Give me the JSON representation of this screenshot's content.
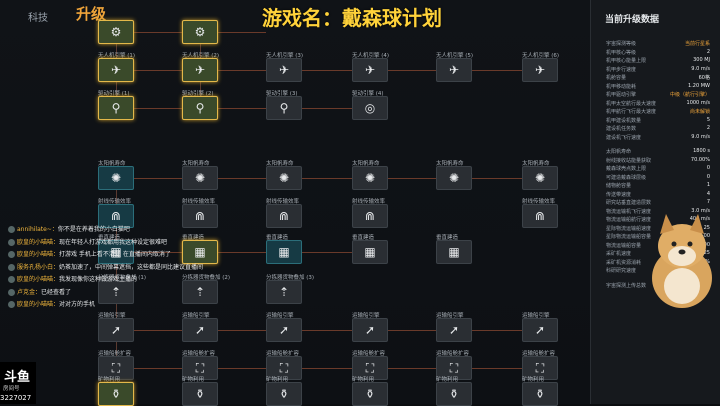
{
  "header": {
    "tech_tab": "科技",
    "upgrade_label": "升级",
    "game_title": "游戏名：戴森球计划"
  },
  "nodes": [
    {
      "id": "r0c0",
      "label": "",
      "glyph": "⚙",
      "hl": true
    },
    {
      "id": "r0c1",
      "label": "",
      "glyph": "⚙",
      "hl": true
    },
    {
      "id": "r1c0",
      "label": "无人机引擎 (1)",
      "glyph": "✈",
      "hl": true
    },
    {
      "id": "r1c1",
      "label": "无人机引擎 (2)",
      "glyph": "✈",
      "hl": true
    },
    {
      "id": "r1c2",
      "label": "无人机引擎 (3)",
      "glyph": "✈"
    },
    {
      "id": "r1c3",
      "label": "无人机引擎 (4)",
      "glyph": "✈"
    },
    {
      "id": "r1c4",
      "label": "无人机引擎 (5)",
      "glyph": "✈"
    },
    {
      "id": "r1c5",
      "label": "无人机引擎 (6)",
      "glyph": "✈"
    },
    {
      "id": "r2c0",
      "label": "驱动引擎 (1)",
      "glyph": "⚲",
      "hl": true
    },
    {
      "id": "r2c1",
      "label": "驱动引擎 (2)",
      "glyph": "⚲",
      "hl": true
    },
    {
      "id": "r2c2",
      "label": "驱动引擎 (3)",
      "glyph": "⚲"
    },
    {
      "id": "r2c3",
      "label": "驱动引擎 (4)",
      "glyph": "◎"
    },
    {
      "id": "r3c0",
      "label": "太阳帆寿命",
      "glyph": "✺",
      "teal": true
    },
    {
      "id": "r3c1",
      "label": "太阳帆寿命",
      "glyph": "✺"
    },
    {
      "id": "r3c2",
      "label": "太阳帆寿命",
      "glyph": "✺"
    },
    {
      "id": "r3c3",
      "label": "太阳帆寿命",
      "glyph": "✺"
    },
    {
      "id": "r3c4",
      "label": "太阳帆寿命",
      "glyph": "✺"
    },
    {
      "id": "r3c5",
      "label": "太阳帆寿命",
      "glyph": "✺"
    },
    {
      "id": "r4c0",
      "label": "射线传输效率",
      "glyph": "⋒",
      "teal": true
    },
    {
      "id": "r4c1",
      "label": "射线传输效率",
      "glyph": "⋒"
    },
    {
      "id": "r4c2",
      "label": "射线传输效率",
      "glyph": "⋒"
    },
    {
      "id": "r4c3",
      "label": "射线传输效率",
      "glyph": "⋒"
    },
    {
      "id": "r4c5",
      "label": "射线传输效率",
      "glyph": "⋒"
    },
    {
      "id": "r5c0",
      "label": "垂直建造",
      "glyph": "▦",
      "teal": true
    },
    {
      "id": "r5c1",
      "label": "垂直建造",
      "glyph": "▦",
      "hl": true
    },
    {
      "id": "r5c2",
      "label": "垂直建造",
      "glyph": "▦",
      "teal": true
    },
    {
      "id": "r5c3",
      "label": "垂直建造",
      "glyph": "▦"
    },
    {
      "id": "r5c4",
      "label": "垂直建造",
      "glyph": "▦"
    },
    {
      "id": "r6c0",
      "label": "分拣器货物叠加 (1)",
      "glyph": "⇡"
    },
    {
      "id": "r6c1",
      "label": "分拣器货物叠加 (2)",
      "glyph": "⇡"
    },
    {
      "id": "r6c2",
      "label": "分拣器货物叠加 (3)",
      "glyph": "⇡"
    },
    {
      "id": "r7c0",
      "label": "运输船引擎",
      "glyph": "➚"
    },
    {
      "id": "r7c1",
      "label": "运输船引擎",
      "glyph": "➚"
    },
    {
      "id": "r7c2",
      "label": "运输船引擎",
      "glyph": "➚"
    },
    {
      "id": "r7c3",
      "label": "运输船引擎",
      "glyph": "➚"
    },
    {
      "id": "r7c4",
      "label": "运输船引擎",
      "glyph": "➚"
    },
    {
      "id": "r7c5",
      "label": "运输船引擎",
      "glyph": "➚"
    },
    {
      "id": "r8c0",
      "label": "运输船舱扩容",
      "glyph": "⛶"
    },
    {
      "id": "r8c1",
      "label": "运输船舱扩容",
      "glyph": "⛶"
    },
    {
      "id": "r8c2",
      "label": "运输船舱扩容",
      "glyph": "⛶"
    },
    {
      "id": "r8c3",
      "label": "运输船舱扩容",
      "glyph": "⛶"
    },
    {
      "id": "r8c4",
      "label": "运输船舱扩容",
      "glyph": "⛶"
    },
    {
      "id": "r8c5",
      "label": "运输船舱扩容",
      "glyph": "⛶"
    },
    {
      "id": "r9c0",
      "label": "矿物利用",
      "glyph": "⚱",
      "hl": true
    },
    {
      "id": "r9c1",
      "label": "矿物利用",
      "glyph": "⚱"
    },
    {
      "id": "r9c2",
      "label": "矿物利用",
      "glyph": "⚱"
    },
    {
      "id": "r9c3",
      "label": "矿物利用",
      "glyph": "⚱"
    },
    {
      "id": "r9c4",
      "label": "矿物利用",
      "glyph": "⚱"
    },
    {
      "id": "r9c5",
      "label": "矿物利用",
      "glyph": "⚱"
    }
  ],
  "panel": {
    "title": "当前升级数据",
    "rows": [
      {
        "k": "宇宙探测等级",
        "v": "当前行星系",
        "o": true
      },
      {
        "k": "机甲核心等级",
        "v": "2"
      },
      {
        "k": "机甲核心能量上限",
        "v": "300 MJ"
      },
      {
        "k": "机甲步行速度",
        "v": "9.0 m/s"
      },
      {
        "k": "机舱容量",
        "v": "60格"
      },
      {
        "k": "机甲移动能耗",
        "v": "1.20 MW"
      },
      {
        "k": "机甲驱动引擎",
        "v": "中级（航行引擎）",
        "o": true
      },
      {
        "k": "机甲太空航行最大速度",
        "v": "1000 m/s"
      },
      {
        "k": "机甲航行飞行最大速度",
        "v": "尚未解锁",
        "o": true
      },
      {
        "k": "机甲建设机数量",
        "v": "5"
      },
      {
        "k": "建设机任务数",
        "v": "2"
      },
      {
        "k": "建设机飞行速度",
        "v": "9.0 m/s"
      },
      {
        "k": "",
        "v": ""
      },
      {
        "k": "太阳帆寿命",
        "v": "1800 s"
      },
      {
        "k": "射线接收站能量获取",
        "v": "70.00%"
      },
      {
        "k": "戴森球壳点数上限",
        "v": "0"
      },
      {
        "k": "可建造戴森球层级",
        "v": "0"
      },
      {
        "k": "储物舱容量",
        "v": "1"
      },
      {
        "k": "传送带速度",
        "v": "4"
      },
      {
        "k": "研究站垂直建造层数",
        "v": "7"
      },
      {
        "k": "物流运输机飞行速度",
        "v": "3.0 m/s"
      },
      {
        "k": "物流运输船航行速度",
        "v": "400 m/s"
      },
      {
        "k": "星际物流运输船速度",
        "v": "25"
      },
      {
        "k": "星际物流运输船容量",
        "v": "500"
      },
      {
        "k": "物流运输船容量",
        "v": "100"
      },
      {
        "k": "采矿机速度",
        "v": "25"
      },
      {
        "k": "采矿机资源消耗",
        "v": "100%"
      },
      {
        "k": "科研研究速度",
        "v": "1"
      },
      {
        "k": "",
        "v": ""
      },
      {
        "k": "宇宙探测上传总数",
        "v": "0"
      }
    ]
  },
  "chat": [
    {
      "name": "annihilate~：",
      "text": "你不是在养着我的小白猫吧"
    },
    {
      "name": "欧皇的小喵喵：",
      "text": "现在年轻人打游戏都用我这种设定很难吧"
    },
    {
      "name": "欧皇的小喵喵：",
      "text": "打游戏 手机上看不清楚 在直播间内取消了"
    },
    {
      "name": "服务孔杨小白：",
      "text": "奶茶加速了，中间弹幕遮挡，这些都是同比建议直播间"
    },
    {
      "name": "欧皇的小喵喵：",
      "text": "我发现像你这种做游戏主播的"
    },
    {
      "name": "卢克金：",
      "text": "已经查看了"
    },
    {
      "name": "欧皇的小喵喵：",
      "text": "对对方的手机"
    }
  ],
  "logo": {
    "brand": "斗鱼",
    "sub": "房间号",
    "room": "3227027"
  }
}
